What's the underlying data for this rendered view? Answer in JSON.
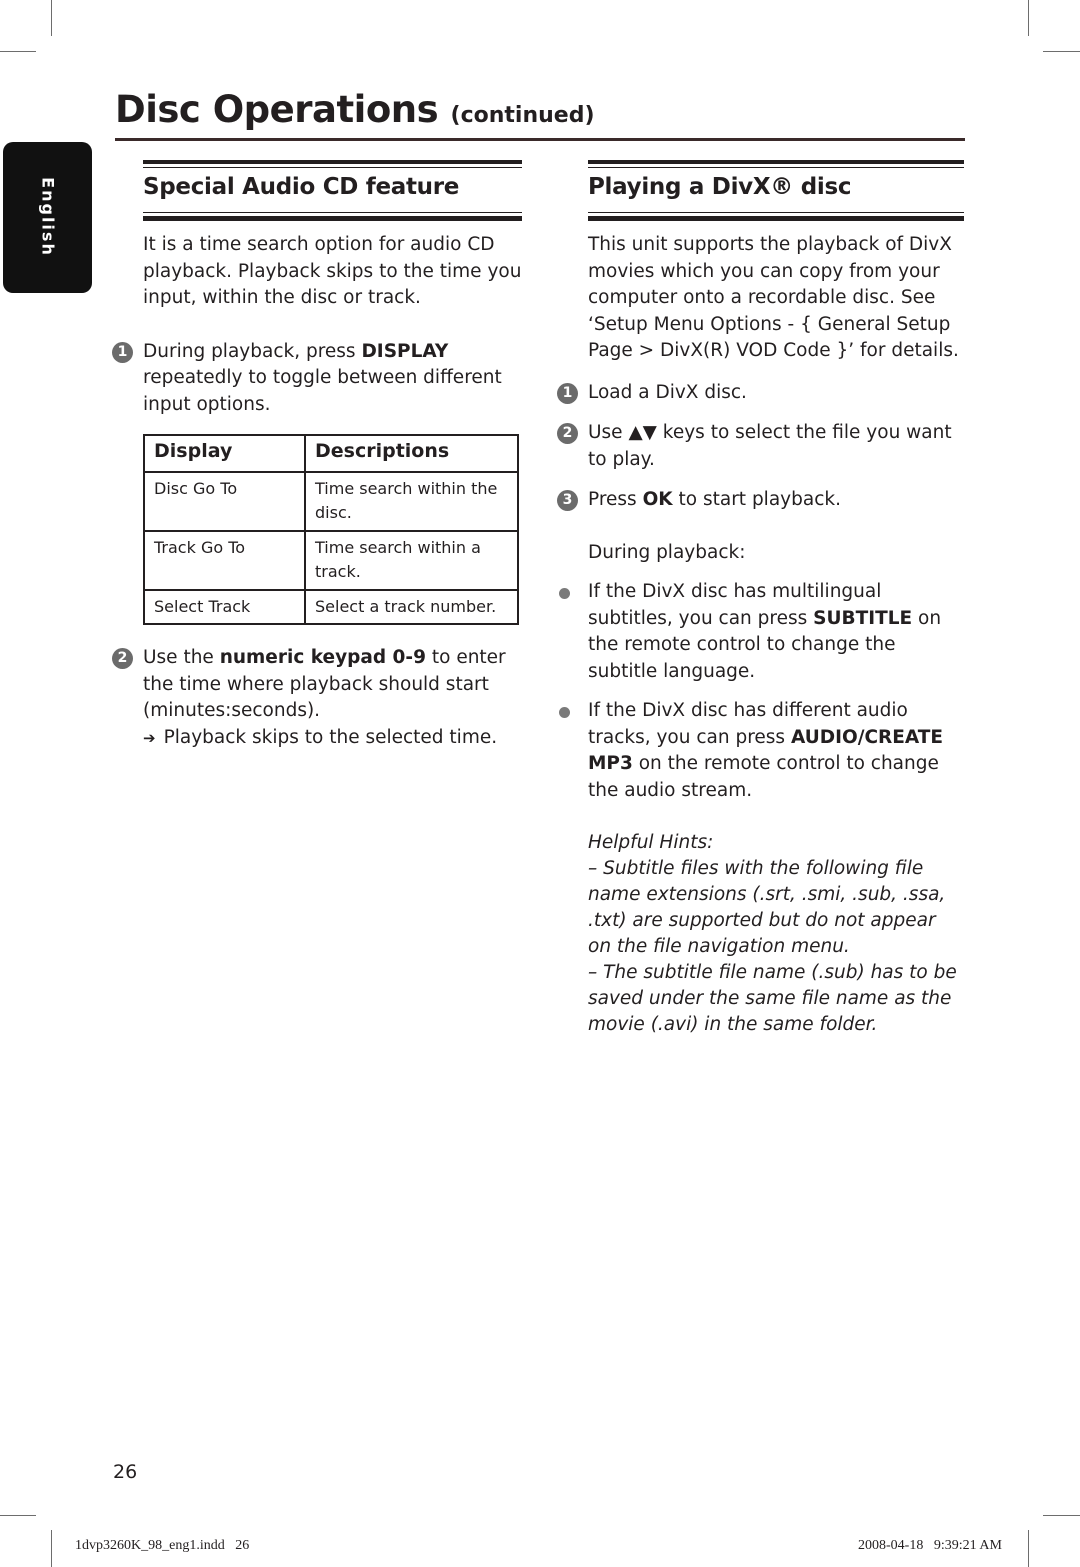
{
  "page": {
    "title": "Disc Operations",
    "title_suffix": "(continued)",
    "language_tab": "English",
    "page_number": "26",
    "slug_file": "1dvp3260K_98_eng1.indd   26",
    "slug_timestamp": "2008-04-18   9:39:21 AM"
  },
  "left": {
    "heading": "Special Audio CD feature",
    "intro": "It is a time search option for audio CD playback. Playback skips to the time you input, within the disc or track.",
    "step1": {
      "num": "1",
      "pre": "During playback, press ",
      "bold": "DISPLAY",
      "post": " repeatedly to toggle between different input options."
    },
    "table": {
      "headers": [
        "Display",
        "Descriptions"
      ],
      "rows": [
        [
          "Disc Go To",
          "Time search within the disc."
        ],
        [
          "Track Go To",
          "Time search within a track."
        ],
        [
          "Select Track",
          "Select a track number."
        ]
      ]
    },
    "step2": {
      "num": "2",
      "pre": "Use the ",
      "bold": "numeric keypad 0-9",
      "post": " to enter the time where playback should start (minutes:seconds).",
      "arrow": "➔",
      "result": "Playback skips to the selected time."
    }
  },
  "right": {
    "heading": "Playing a DivX® disc",
    "intro": "This unit supports the playback of DivX movies which you can copy from your computer onto a recordable disc. See ‘Setup Menu Options - { General Setup Page > DivX(R) VOD Code }’ for details.",
    "step1": {
      "num": "1",
      "text": "Load a DivX disc."
    },
    "step2": {
      "num": "2",
      "pre": "Use ",
      "keys": "▲▼",
      "post": " keys to select the file you want to play."
    },
    "step3": {
      "num": "3",
      "pre": "Press ",
      "bold": "OK",
      "post": " to start playback."
    },
    "during": "During playback:",
    "bullets": [
      {
        "pre": "If the DivX disc has multilingual subtitles, you can press ",
        "bold": "SUBTITLE",
        "post": " on the remote control to change the subtitle language."
      },
      {
        "pre": "If the DivX disc has different audio tracks, you can press ",
        "bold": "AUDIO/CREATE MP3",
        "post": " on the remote control to change the audio stream."
      }
    ],
    "hints": {
      "title": "Helpful Hints:",
      "items": [
        "–  Subtitle files with the following file name extensions (.srt, .smi, .sub, .ssa, .txt) are supported but do not appear on the file navigation menu.",
        "–  The subtitle file name (.sub) has to be saved under the same file name as the movie (.avi) in the same folder."
      ]
    }
  }
}
